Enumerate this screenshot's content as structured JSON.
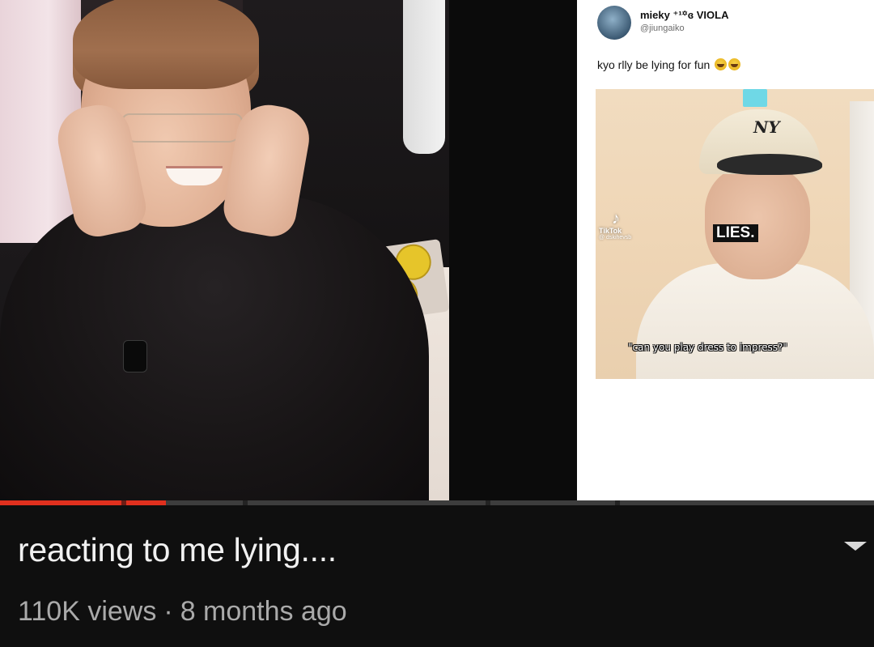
{
  "tweet": {
    "display_name": "mieky ⁺¹꙳ɞ VIOLA",
    "handle": "@jiungaiko",
    "text": "kyo rlly be lying for fun",
    "emoji_icons": [
      "loudly-crying-face-icon",
      "loudly-crying-face-icon"
    ],
    "media": {
      "cap_logo": "NY",
      "watermark": "TikTok",
      "watermark_sub": "@ dskihevsb",
      "overlay_text": "LIES.",
      "caption": "\"can you play dress to impress?\""
    }
  },
  "player": {
    "progress": 0.19,
    "progress_color": "#e0301e"
  },
  "video_info": {
    "title": "reacting to me lying....",
    "views": "110K views",
    "separator": "·",
    "age": "8 months ago",
    "expand_icon": "chevron-down-icon"
  }
}
